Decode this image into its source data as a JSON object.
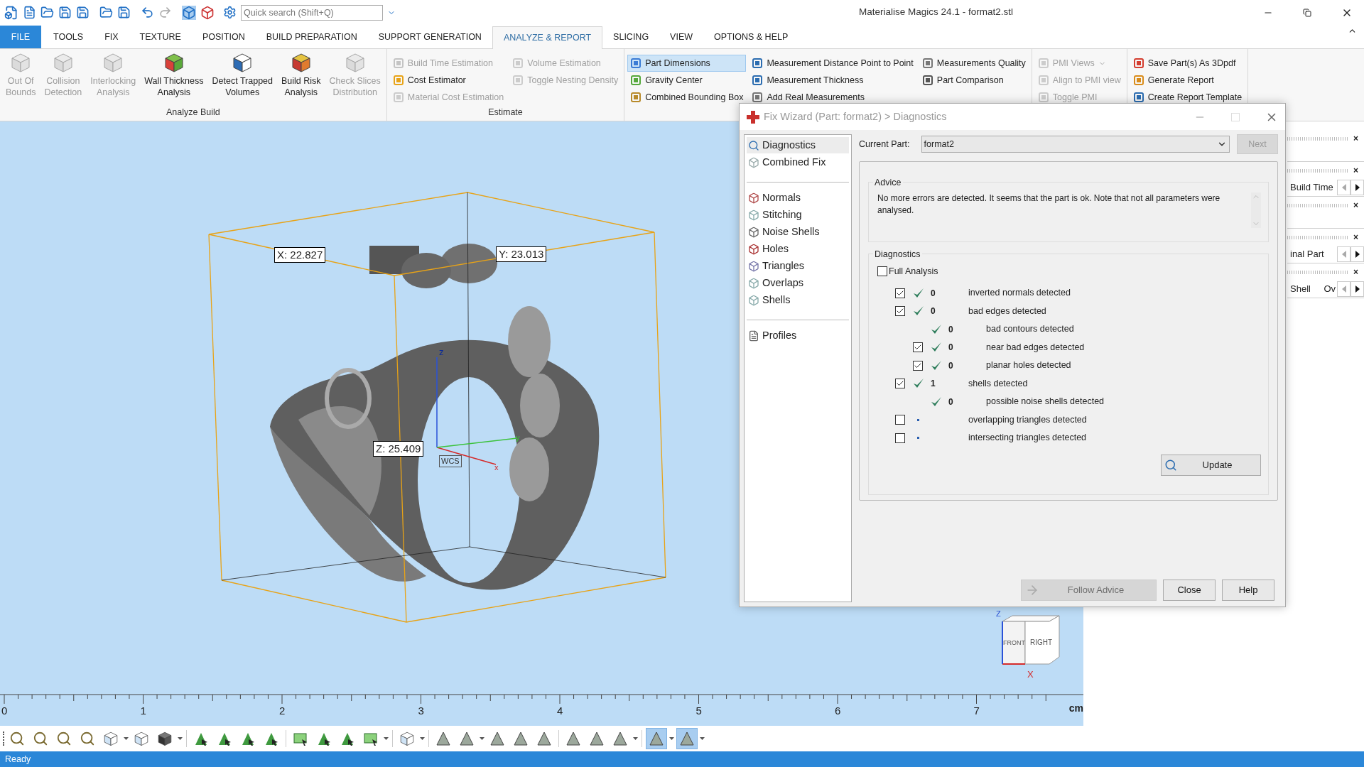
{
  "window": {
    "title": "Materialise Magics 24.1 - format2.stl"
  },
  "search": {
    "placeholder": "Quick search (Shift+Q)"
  },
  "menu_tabs": [
    {
      "label": "FILE",
      "kind": "file"
    },
    {
      "label": "TOOLS",
      "kind": "tab",
      "selected": false
    },
    {
      "label": "FIX",
      "kind": "tab",
      "selected": false
    },
    {
      "label": "TEXTURE",
      "kind": "tab",
      "selected": false
    },
    {
      "label": "POSITION",
      "kind": "tab",
      "selected": false
    },
    {
      "label": "BUILD PREPARATION",
      "kind": "tab",
      "selected": false
    },
    {
      "label": "SUPPORT GENERATION",
      "kind": "tab",
      "selected": false
    },
    {
      "label": "ANALYZE & REPORT",
      "kind": "tab",
      "selected": true
    },
    {
      "label": "SLICING",
      "kind": "tab",
      "selected": false
    },
    {
      "label": "VIEW",
      "kind": "tab",
      "selected": false
    },
    {
      "label": "OPTIONS & HELP",
      "kind": "tab",
      "selected": false
    }
  ],
  "ribbon_groups": [
    {
      "title": "Analyze Build",
      "kind": "large",
      "items": [
        {
          "label": "Out Of\nBounds",
          "disabled": true
        },
        {
          "label": "Collision\nDetection",
          "disabled": true
        },
        {
          "label": "Interlocking\nAnalysis",
          "disabled": true
        },
        {
          "label": "Wall Thickness\nAnalysis",
          "disabled": false
        },
        {
          "label": "Detect Trapped\nVolumes",
          "disabled": false
        },
        {
          "label": "Build Risk\nAnalysis",
          "disabled": false
        },
        {
          "label": "Check Slices\nDistribution",
          "disabled": true
        }
      ]
    },
    {
      "title": "Estimate",
      "kind": "small",
      "items": [
        {
          "label": "Build Time Estimation",
          "disabled": true,
          "selected": false
        },
        {
          "label": "Cost Estimator",
          "disabled": false,
          "selected": false
        },
        {
          "label": "Material Cost Estimation",
          "disabled": true,
          "selected": false
        },
        {
          "label": "Volume Estimation",
          "disabled": true,
          "selected": false
        },
        {
          "label": "Toggle Nesting Density",
          "disabled": true,
          "selected": false
        }
      ]
    },
    {
      "kind": "small",
      "items": [
        {
          "label": "Part Dimensions",
          "disabled": false,
          "selected": true
        },
        {
          "label": "Gravity Center",
          "disabled": false,
          "selected": false
        },
        {
          "label": "Combined Bounding Box",
          "disabled": false,
          "selected": false
        },
        {
          "label": "Measurement Distance Point to Point",
          "disabled": false,
          "selected": false
        },
        {
          "label": "Measurement Thickness",
          "disabled": false,
          "selected": false
        },
        {
          "label": "Add Real Measurements",
          "disabled": false,
          "selected": false
        },
        {
          "label": "Measurements Quality",
          "disabled": false,
          "selected": false
        },
        {
          "label": "Part Comparison",
          "disabled": false,
          "selected": false
        }
      ]
    },
    {
      "kind": "small",
      "items": [
        {
          "label": "PMI Views",
          "disabled": true,
          "selected": false
        },
        {
          "label": "Align to PMI view",
          "disabled": true,
          "selected": false
        },
        {
          "label": "Toggle PMI",
          "disabled": true,
          "selected": false
        }
      ]
    },
    {
      "kind": "small",
      "items": [
        {
          "label": "Save Part(s) As 3Dpdf",
          "disabled": false,
          "selected": false
        },
        {
          "label": "Generate Report",
          "disabled": false,
          "selected": false
        },
        {
          "label": "Create Report Template",
          "disabled": false,
          "selected": false
        }
      ]
    }
  ],
  "viewport": {
    "x_label": "X: 22.827",
    "y_label": "Y: 23.013",
    "z_label": "Z: 25.409",
    "wcs": "WCS",
    "axis_z": "z",
    "axis_y": "y",
    "axis_x": "x",
    "view_cube": {
      "front": "FRONT",
      "right": "RIGHT",
      "z_axis": "Z",
      "x_axis": "X"
    }
  },
  "side_panels": [
    {
      "close": "×"
    },
    {
      "close": "×",
      "label": "Build Time"
    },
    {
      "close": "×"
    },
    {
      "close": "×",
      "label": "inal Part"
    },
    {
      "close": "×",
      "label": "Shell",
      "label_2": "Ov"
    }
  ],
  "fix_wizard": {
    "title": "Fix Wizard (Part: format2) > Diagnostics",
    "nav_sections": [
      {
        "items": [
          {
            "label": "Diagnostics",
            "selected": true
          },
          {
            "label": "Combined Fix",
            "selected": false
          }
        ]
      },
      {
        "items": [
          {
            "label": "Normals",
            "selected": false
          },
          {
            "label": "Stitching",
            "selected": false
          },
          {
            "label": "Noise Shells",
            "selected": false
          },
          {
            "label": "Holes",
            "selected": false
          },
          {
            "label": "Triangles",
            "selected": false
          },
          {
            "label": "Overlaps",
            "selected": false
          },
          {
            "label": "Shells",
            "selected": false
          }
        ]
      },
      {
        "items": [
          {
            "label": "Profiles",
            "selected": false
          }
        ]
      }
    ],
    "current_part": {
      "label": "Current Part:",
      "value": "format2"
    },
    "next_button": {
      "label": "Next",
      "disabled": true
    },
    "advice": {
      "title": "Advice",
      "text": "No more errors are detected. It seems that the part is ok. Note that not all parameters were analysed."
    },
    "diagnostics": {
      "title": "Diagnostics",
      "full_analysis": {
        "label": "Full Analysis",
        "checked": false
      },
      "checks": [
        {
          "checkable": true,
          "checked": true,
          "passed": true,
          "count": "0",
          "label": "inverted normals detected"
        },
        {
          "checkable": true,
          "checked": true,
          "passed": true,
          "count": "0",
          "label": "bad edges detected",
          "children": [
            {
              "checkable": false,
              "passed": true,
              "count": "0",
              "label": "bad contours detected"
            },
            {
              "checkable": true,
              "checked": true,
              "passed": true,
              "count": "0",
              "label": "near bad edges detected"
            },
            {
              "checkable": true,
              "checked": true,
              "passed": true,
              "count": "0",
              "label": "planar holes detected"
            }
          ]
        },
        {
          "checkable": true,
          "checked": true,
          "passed": true,
          "count": "1",
          "label": "shells detected",
          "children": [
            {
              "checkable": false,
              "passed": true,
              "count": "0",
              "label": "possible noise shells detected"
            }
          ]
        },
        {
          "checkable": true,
          "checked": false,
          "passed": false,
          "label": "overlapping triangles detected"
        },
        {
          "checkable": true,
          "checked": false,
          "passed": false,
          "label": "intersecting triangles detected"
        }
      ],
      "update_button": {
        "label": "Update"
      }
    },
    "buttons": [
      {
        "label": "Follow Advice",
        "kind": "follow",
        "disabled": true
      },
      {
        "label": "Close",
        "kind": "plain",
        "disabled": false
      },
      {
        "label": "Help",
        "kind": "plain",
        "disabled": false
      }
    ]
  },
  "ruler": {
    "ticks": [
      "0",
      "1",
      "2",
      "3",
      "4",
      "5",
      "6",
      "7"
    ],
    "unit": "cm"
  },
  "toolbar": [
    {
      "kind": "zoom",
      "selected": false
    },
    {
      "kind": "zoom",
      "selected": false
    },
    {
      "kind": "zoom",
      "selected": false
    },
    {
      "kind": "zoom",
      "selected": false
    },
    {
      "kind": "cube",
      "selected": false
    },
    {
      "kind": "caret",
      "selected": false
    },
    {
      "kind": "cube",
      "selected": false
    },
    {
      "kind": "solid",
      "selected": false
    },
    {
      "kind": "caret",
      "selected": false
    },
    {
      "kind": "sep",
      "selected": false
    },
    {
      "kind": "pick",
      "selected": false
    },
    {
      "kind": "pick",
      "selected": false
    },
    {
      "kind": "pick",
      "selected": false
    },
    {
      "kind": "pick",
      "selected": false
    },
    {
      "kind": "sep",
      "selected": false
    },
    {
      "kind": "rect",
      "selected": false
    },
    {
      "kind": "pick",
      "selected": false
    },
    {
      "kind": "pick",
      "selected": false
    },
    {
      "kind": "rect",
      "selected": false
    },
    {
      "kind": "caret",
      "selected": false
    },
    {
      "kind": "sep",
      "selected": false
    },
    {
      "kind": "cube",
      "selected": false
    },
    {
      "kind": "caret",
      "selected": false
    },
    {
      "kind": "sep",
      "selected": false
    },
    {
      "kind": "tri",
      "selected": false
    },
    {
      "kind": "tri",
      "selected": false
    },
    {
      "kind": "caret",
      "selected": false
    },
    {
      "kind": "tri",
      "selected": false
    },
    {
      "kind": "tri",
      "selected": false
    },
    {
      "kind": "tri",
      "selected": false
    },
    {
      "kind": "sep",
      "selected": false
    },
    {
      "kind": "tri",
      "selected": false
    },
    {
      "kind": "tri",
      "selected": false
    },
    {
      "kind": "tri",
      "selected": false
    },
    {
      "kind": "caret",
      "selected": false
    },
    {
      "kind": "sep",
      "selected": false
    },
    {
      "kind": "tri",
      "selected": true
    },
    {
      "kind": "caret",
      "selected": false
    },
    {
      "kind": "tri",
      "selected": true
    },
    {
      "kind": "caret",
      "selected": false
    }
  ],
  "status_bar": {
    "text": "Ready"
  }
}
